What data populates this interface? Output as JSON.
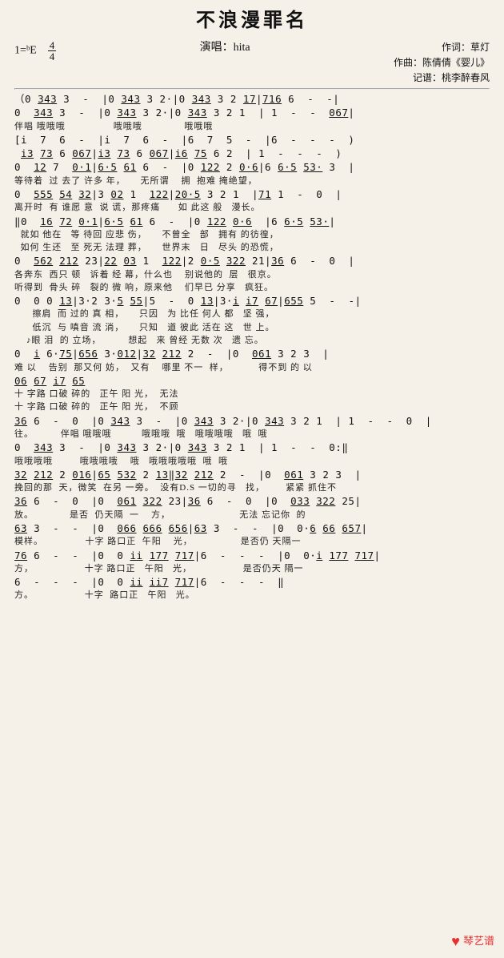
{
  "title": "不浪漫罪名",
  "key": "1=ᵇE",
  "time": "4/4",
  "performer_label": "演唱：",
  "performer": "hita",
  "credits": {
    "lyricist": "作词：草灯",
    "composer": "作曲：陈倩倩《婴儿》",
    "transcriber": "记谱：桃李醉春风"
  },
  "watermark": "琴艺谱",
  "score_lines": [
    {
      "type": "score",
      "text": "（0 <u>343</u> 3  -  |0 <u>343</u> 3 2·|0 <u>343</u> 3 2 <u>17</u>|<u>716</u> 6  -  -|"
    },
    {
      "type": "score",
      "text": "0  <u>343</u> 3  -  |0 <u>343</u> 3 2·|0 <u>343</u> 3 2 1  | 1  -  -  <u>067</u>|"
    },
    {
      "type": "lyrics",
      "text": "伴唱 哦哦哦                哦哦哦              哦哦哦"
    },
    {
      "type": "score",
      "text": "[i  7  6  -  |i  7  6  -  |6  7  5  -  |6  -  -  -  )"
    },
    {
      "type": "score",
      "text": " <u>i3</u> <u>73</u> 6 <u>067</u>|<u>i3</u> <u>73</u> 6 <u>067</u>|<u>i6</u> <u>75</u> 6 2  | 1  -  -  -  )"
    },
    {
      "type": "score",
      "text": "0  <u>12</u> 7  <u>0·1</u>|<u>6·5</u> <u>61</u> 6  -  |0 <u>122</u> 2 <u>0·6</u>|6 <u>6·5</u> <u>53·</u> 3  |"
    },
    {
      "type": "lyrics",
      "text": "等待着  过 去了 许多 年，     无所谓    拥  抱难 掩绝望，"
    },
    {
      "type": "score",
      "text": "0  <u>555</u> <u>54</u> <u>32</u>|3 <u>02</u> 1  <u>122</u>|<u>20·5</u> 3 2 1  |<u>71</u> 1  -  0  |"
    },
    {
      "type": "lyrics",
      "text": "离开时  有 谁愿 意  说 谎，那疼痛      如 此这 般   漫长。"
    },
    {
      "type": "score",
      "text": "‖0  <u>16</u> <u>72</u> <u>0·1</u>|<u>6·5</u> <u>61</u> 6  -  |0 <u>122</u> <u>0·6</u>  |6 <u>6·5</u> <u>53·</u>|"
    },
    {
      "type": "lyrics",
      "text": "  就如 他在   等 待回 应悲 伤，     不曾全   部   拥有 的彷徨，"
    },
    {
      "type": "lyrics",
      "text": "  如何 生还   至 死无 法理 葬，     世界末   日   尽头 的恐慌，"
    },
    {
      "type": "score",
      "text": "0  <u>562</u> <u>212</u> 23|<u>22</u> <u>03</u> 1  <u>122</u>|2 <u>0·5</u> <u>322</u> 21|<u>36</u> 6  -  0  |"
    },
    {
      "type": "lyrics",
      "text": "各奔东  西只 顿   诉着 经 幕，什么也    别说他的  层   很京。"
    },
    {
      "type": "lyrics",
      "text": "听得到  骨头 碎   裂的 微 响，原来他    们早已 分享   疯狂。"
    },
    {
      "type": "score",
      "text": "0  0 0 <u>13</u>|3·2 3·<u>5</u> <u>55</u>|5  -  0 <u>13</u>|3·<u>i</u> <u>i7</u> <u>67</u>|<u>655</u> 5  -  -|"
    },
    {
      "type": "lyrics",
      "text": "      擦肩  而 过的 真 相，     只因   为 比任 何人 都   坚 强，"
    },
    {
      "type": "lyrics",
      "text": "      低沉  与 嗔音 流 淌，     只知   道 彼此 活在 这   世 上。"
    },
    {
      "type": "lyrics",
      "text": "    ♪眼 泪  的 立场，         想起   来 曾经 无数 次   遗 忘。"
    },
    {
      "type": "score",
      "text": "0  <u>i</u> 6·<u>75</u>|<u>656</u> 3·<u>012</u>|<u>32</u> <u>212</u> 2  -  |0  <u>061</u> 3 2 3  |"
    },
    {
      "type": "lyrics",
      "text": "难 以    告别  那又何 妨，  又有    哪里 不一  样，          得不到 的 以"
    },
    {
      "type": "score",
      "text": "<u>06</u> <u>67</u> <u>i7</u> <u>65</u>"
    },
    {
      "type": "lyrics",
      "text": "十 字路 口破 碎的   正午 阳 光，  无法"
    },
    {
      "type": "lyrics",
      "text": "十 字路 口破 碎的   正午 阳 光，  不顾"
    },
    {
      "type": "score",
      "text": "<u>36</u> 6  -  0  |0 <u>343</u> 3  -  |0 <u>343</u> 3 2·|0 <u>343</u> 3 2 1  | 1  -  -  0  |"
    },
    {
      "type": "lyrics",
      "text": "往。         伴唱 哦哦哦          哦哦哦  哦   哦哦哦哦   哦  哦"
    },
    {
      "type": "score",
      "text": "0  <u>343</u> 3  -  |0 <u>343</u> 3 2·|0 <u>343</u> 3 2 1  | 1  -  -  0:‖"
    },
    {
      "type": "lyrics",
      "text": "哦哦哦哦         哦哦哦哦    哦   哦哦哦哦哦  哦  哦"
    },
    {
      "type": "score",
      "text": "<u>32</u> <u>212</u> 2 <u>016</u>|<u>65</u> <u>532</u> 2 <u>13</u>‖<u>32</u> <u>212</u> 2  -  |0  <u>061</u> 3 2 3  |"
    },
    {
      "type": "lyrics",
      "text": "挽回的那  天，微笑  在另 一旁。  没有D.S 一切的寻   找，       紧紧 抓住不"
    },
    {
      "type": "score",
      "text": "<u>36</u> 6  -  0  |0  <u>061</u> <u>322</u> 23|<u>36</u> 6  -  0  |0  <u>033</u> <u>322</u> 25|"
    },
    {
      "type": "lyrics",
      "text": "放。            是否  仍天隔  一    方，                       无法 忘记你  的"
    },
    {
      "type": "score",
      "text": "<u>63</u> 3  -  -  |0  <u>066</u> <u>666</u> <u>656</u>|<u>63</u> 3  -  -  |0  0·<u>6</u> <u>66</u> <u>657</u>|"
    },
    {
      "type": "lyrics",
      "text": "模样。              十字 路口正  午阳    光，                是否仍 天隔一"
    },
    {
      "type": "score",
      "text": "<u>76</u> 6  -  -  |0  0 <u>ii</u> <u>177</u> <u>717</u>|6  -  -  -  |0  0·<u>i</u> <u>177</u> <u>717</u>|"
    },
    {
      "type": "lyrics",
      "text": "方，                 十字 路口正   午阳   光，                 是否仍天 隔一"
    },
    {
      "type": "score",
      "text": "6  -  -  -  |0  0 <u>ii</u> <u>ii7</u> <u>717</u>|6  -  -  -  ‖"
    },
    {
      "type": "lyrics",
      "text": "方。                 十字  路口正   午阳   光。"
    }
  ]
}
